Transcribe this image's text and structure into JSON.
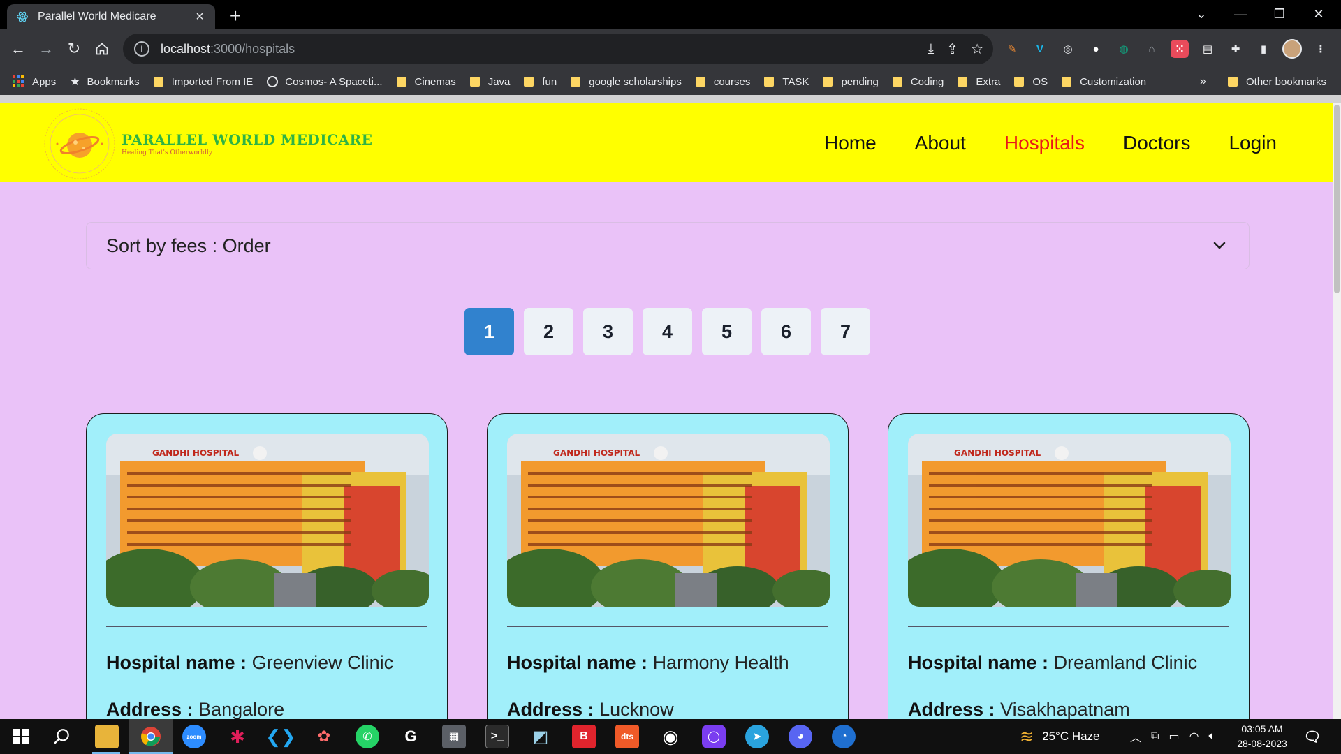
{
  "browser": {
    "tab_title": "Parallel World Medicare",
    "url_host": "localhost",
    "url_path": ":3000/hospitals",
    "bookmarks": [
      "Apps",
      "Bookmarks",
      "Imported From IE",
      "Cosmos- A Spaceti...",
      "Cinemas",
      "Java",
      "fun",
      "google scholarships",
      "courses",
      "TASK",
      "pending",
      "Coding",
      "Extra",
      "OS",
      "Customization"
    ],
    "bookmarks_more": "»",
    "other_bookmarks": "Other bookmarks"
  },
  "site": {
    "brand_name": "PARALLEL WORLD MEDICARE",
    "brand_tagline": "Healing That's Otherworldly",
    "nav": [
      {
        "label": "Home"
      },
      {
        "label": "About"
      },
      {
        "label": "Hospitals",
        "active": true
      },
      {
        "label": "Doctors"
      },
      {
        "label": "Login"
      }
    ],
    "sort_label": "Sort by fees : Order",
    "pages": [
      "1",
      "2",
      "3",
      "4",
      "5",
      "6",
      "7"
    ],
    "active_page": "1",
    "field_labels": {
      "name": "Hospital name :",
      "address": "Address :"
    },
    "image_sign": "GANDHI HOSPITAL",
    "hospitals": [
      {
        "name": "Greenview Clinic",
        "address": "Bangalore"
      },
      {
        "name": "Harmony Health",
        "address": "Lucknow"
      },
      {
        "name": "Dreamland Clinic",
        "address": "Visakhapatnam"
      }
    ]
  },
  "taskbar": {
    "weather": "25°C  Haze",
    "time": "03:05 AM",
    "date": "28-08-2023"
  },
  "colors": {
    "nav_bg": "#ffff00",
    "page_bg": "#eac2f8",
    "card_bg": "#a1effa",
    "active_link": "#e91818",
    "active_page": "#3182ce",
    "brand_green": "#2fb344"
  }
}
